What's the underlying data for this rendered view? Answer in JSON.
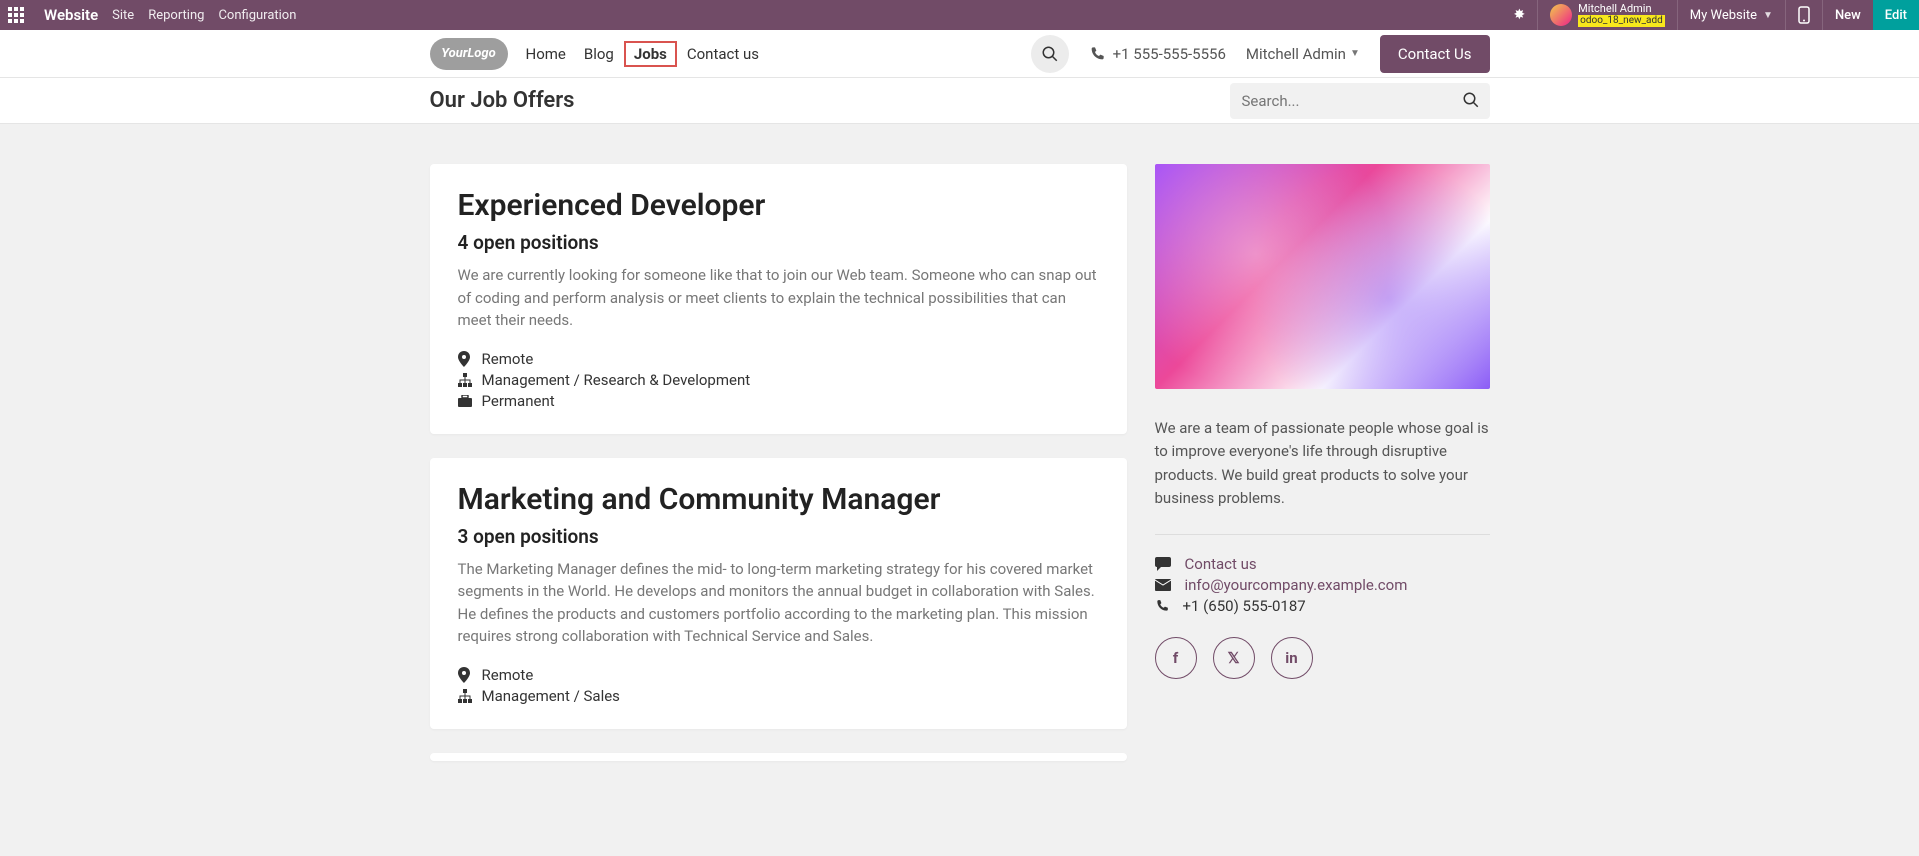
{
  "admin": {
    "brand": "Website",
    "menu": [
      "Site",
      "Reporting",
      "Configuration"
    ],
    "user_name": "Mitchell Admin",
    "db_label": "odoo_18_new_add",
    "website_selector": "My Website",
    "new_btn": "New",
    "edit_btn": "Edit"
  },
  "header": {
    "logo_text": "YourLogo",
    "nav": {
      "home": "Home",
      "blog": "Blog",
      "jobs": "Jobs",
      "contact": "Contact us"
    },
    "phone": "+1 555-555-5556",
    "user": "Mitchell Admin",
    "contact_btn": "Contact Us"
  },
  "subhead": {
    "title": "Our Job Offers",
    "search_placeholder": "Search..."
  },
  "jobs": [
    {
      "title": "Experienced Developer",
      "positions": "4 open positions",
      "desc": "We are currently looking for someone like that to join our Web team. Someone who can snap out of coding and perform analysis or meet clients to explain the technical possibilities that can meet their needs.",
      "location": "Remote",
      "dept": "Management / Research & Development",
      "type": "Permanent"
    },
    {
      "title": "Marketing and Community Manager",
      "positions": "3 open positions",
      "desc": "The Marketing Manager defines the mid- to long-term marketing strategy for his covered market segments in the World. He develops and monitors the annual budget in collaboration with Sales. He defines the products and customers portfolio according to the marketing plan. This mission requires strong collaboration with Technical Service and Sales.",
      "location": "Remote",
      "dept": "Management / Sales",
      "type": ""
    }
  ],
  "side": {
    "about": "We are a team of passionate people whose goal is to improve everyone's life through disruptive products. We build great products to solve your business problems.",
    "contact_label": "Contact us",
    "email": "info@yourcompany.example.com",
    "phone": "+1 (650) 555-0187"
  }
}
